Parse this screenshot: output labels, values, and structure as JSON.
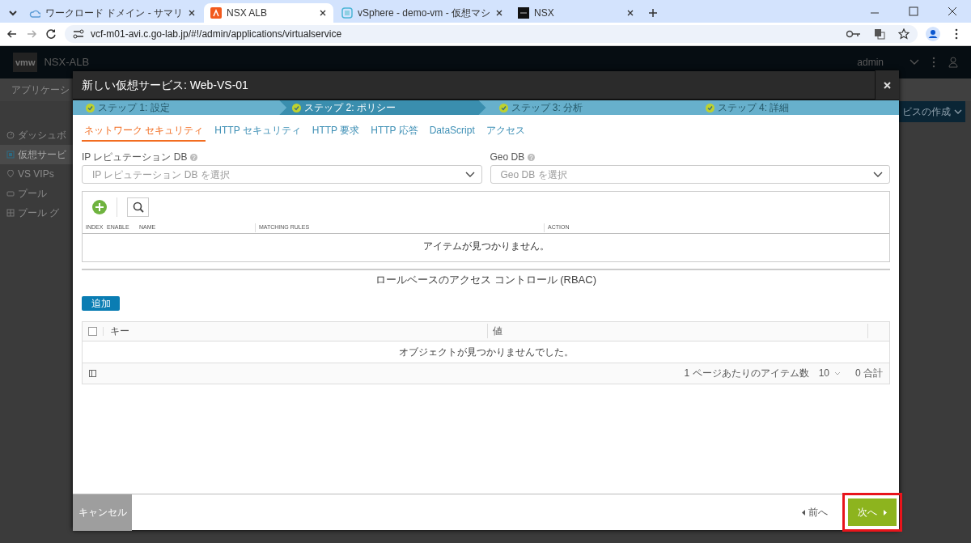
{
  "browser": {
    "tabs": [
      {
        "title": "ワークロード ドメイン - サマリ",
        "selected": false
      },
      {
        "title": "NSX ALB",
        "selected": true
      },
      {
        "title": "vSphere - demo-vm - 仮想マシ",
        "selected": false
      },
      {
        "title": "NSX",
        "selected": false
      }
    ],
    "url": "vcf-m01-avi.c.go-lab.jp/#!/admin/applications/virtualservice"
  },
  "app": {
    "logo": "vmw",
    "brand": "NSX-ALB",
    "user": "admin",
    "section": "アプリケーシ",
    "create_button": "ビスの作成",
    "sidebar": [
      {
        "label": "ダッシュボ",
        "selected": false
      },
      {
        "label": "仮想サービ",
        "selected": true
      },
      {
        "label": "VS VIPs",
        "selected": false
      },
      {
        "label": "プール",
        "selected": false
      },
      {
        "label": "プール グ",
        "selected": false
      }
    ]
  },
  "modal": {
    "title": "新しい仮想サービス: Web-VS-01",
    "steps": [
      {
        "label": "ステップ 1: 設定",
        "done": true,
        "selected": false
      },
      {
        "label": "ステップ 2: ポリシー",
        "done": true,
        "selected": true
      },
      {
        "label": "ステップ 3: 分析",
        "done": true,
        "selected": false
      },
      {
        "label": "ステップ 4: 詳細",
        "done": true,
        "selected": false
      }
    ],
    "tabs": [
      {
        "label": "ネットワーク セキュリティ",
        "selected": true
      },
      {
        "label": "HTTP セキュリティ",
        "selected": false
      },
      {
        "label": "HTTP 要求",
        "selected": false
      },
      {
        "label": "HTTP 応答",
        "selected": false
      },
      {
        "label": "DataScript",
        "selected": false
      },
      {
        "label": "アクセス",
        "selected": false
      }
    ],
    "fields": [
      {
        "label": "IP レピュテーション DB",
        "placeholder": "IP レピュテーション DB を選択"
      },
      {
        "label": "Geo DB",
        "placeholder": "Geo DB を選択"
      }
    ],
    "rules_table": {
      "columns": [
        "INDEX",
        "ENABLE",
        "NAME",
        "MATCHING RULES",
        "ACTION"
      ],
      "empty": "アイテムが見つかりません。"
    },
    "rbac": {
      "heading": "ロールベースのアクセス コントロール (RBAC)",
      "add_button": "追加",
      "select_all_checked": false,
      "columns": [
        "キー",
        "値"
      ],
      "empty": "オブジェクトが見つかりませんでした。",
      "page_size_label": "1 ページあたりのアイテム数",
      "page_size": "10",
      "total": "0 合計"
    },
    "footer": {
      "cancel": "キャンセル",
      "prev": "前へ",
      "next": "次へ",
      "next_highlighted": true
    }
  }
}
